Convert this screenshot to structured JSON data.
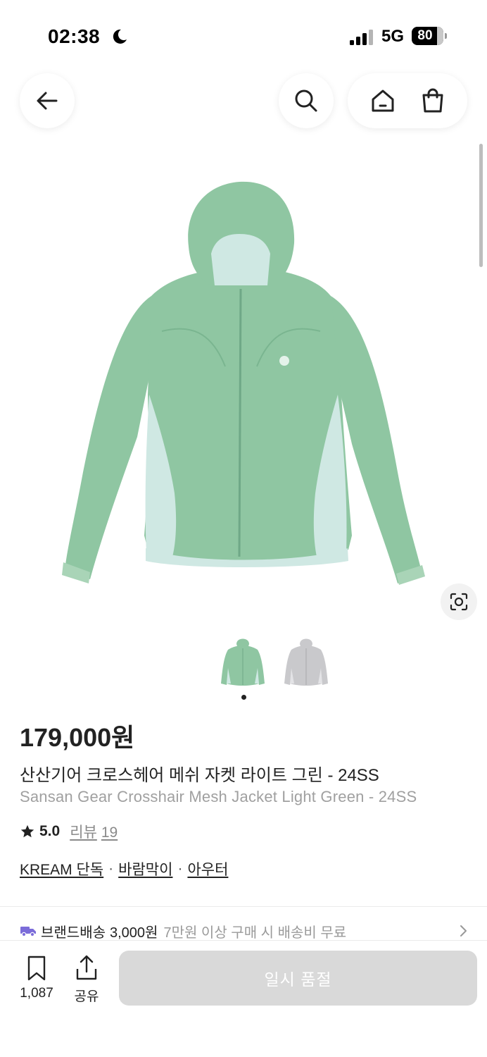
{
  "status_bar": {
    "time": "02:38",
    "network": "5G",
    "battery": "80",
    "battery_level": 0.8,
    "icons": [
      "moon-icon",
      "signal-icon",
      "battery-icon"
    ]
  },
  "nav": {
    "icons": [
      "back-arrow-icon",
      "search-icon",
      "home-icon",
      "shopping-bag-icon"
    ]
  },
  "product": {
    "image_colors": {
      "green": "#8fc6a2",
      "mint": "#cfe8e3",
      "gray": "#c9c9cc"
    },
    "thumbnail_count": 2,
    "active_thumbnail": 0
  },
  "info": {
    "price": "179,000원",
    "title_ko": "산산기어 크로스헤어 메쉬 자켓 라이트 그린 - 24SS",
    "title_en": "Sansan Gear Crosshair Mesh Jacket Light Green - 24SS",
    "rating": "5.0",
    "review_label": "리뷰",
    "review_count": "19",
    "categories": [
      "KREAM 단독",
      "바람막이",
      "아우터"
    ],
    "category_separator": "·"
  },
  "delivery": {
    "label": "브랜드배송",
    "price": "3,000원",
    "note": "7만원 이상 구매 시 배송비 무료"
  },
  "bottom_bar": {
    "bookmark_count": "1,087",
    "share_label": "공유",
    "buy_label": "일시 품절"
  },
  "colors": {
    "text": "#222222",
    "muted": "#a0a0a0",
    "disabled_button": "#d9d9d9",
    "delivery_icon": "#7b6cd9"
  }
}
